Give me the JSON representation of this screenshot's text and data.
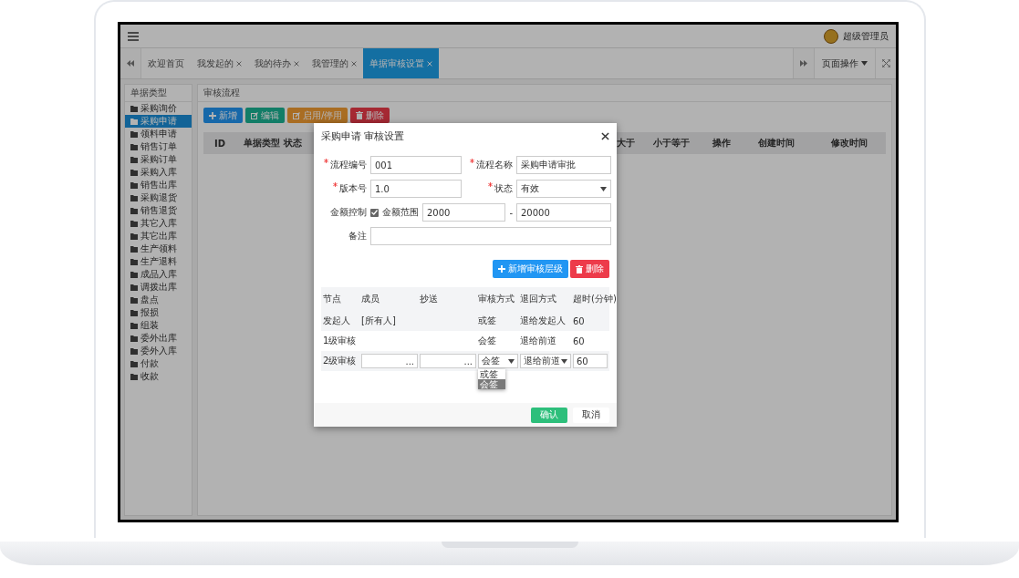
{
  "header": {
    "user": "超级管理员"
  },
  "tabs": [
    {
      "label": "欢迎首页",
      "closable": false,
      "selected": false
    },
    {
      "label": "我发起的",
      "closable": true,
      "selected": false
    },
    {
      "label": "我的待办",
      "closable": true,
      "selected": false
    },
    {
      "label": "我管理的",
      "closable": true,
      "selected": false
    },
    {
      "label": "单据审核设置",
      "closable": true,
      "selected": true
    }
  ],
  "page_menu": "页面操作",
  "sidebar": {
    "title": "单据类型",
    "items": [
      {
        "label": "采购询价",
        "selected": false
      },
      {
        "label": "采购申请",
        "selected": true
      },
      {
        "label": "领料申请",
        "selected": false
      },
      {
        "label": "销售订单",
        "selected": false
      },
      {
        "label": "采购订单",
        "selected": false
      },
      {
        "label": "采购入库",
        "selected": false
      },
      {
        "label": "销售出库",
        "selected": false
      },
      {
        "label": "采购退货",
        "selected": false
      },
      {
        "label": "销售退货",
        "selected": false
      },
      {
        "label": "其它入库",
        "selected": false
      },
      {
        "label": "其它出库",
        "selected": false
      },
      {
        "label": "生产领料",
        "selected": false
      },
      {
        "label": "生产退料",
        "selected": false
      },
      {
        "label": "成品入库",
        "selected": false
      },
      {
        "label": "调拨出库",
        "selected": false
      },
      {
        "label": "盘点",
        "selected": false
      },
      {
        "label": "报损",
        "selected": false
      },
      {
        "label": "组装",
        "selected": false
      },
      {
        "label": "委外出库",
        "selected": false
      },
      {
        "label": "委外入库",
        "selected": false
      },
      {
        "label": "付款",
        "selected": false
      },
      {
        "label": "收款",
        "selected": false
      }
    ]
  },
  "panel": {
    "title": "审核流程",
    "buttons": [
      {
        "label": "新增",
        "kind": "add"
      },
      {
        "label": "编辑",
        "kind": "edit"
      },
      {
        "label": "启用/停用",
        "kind": "toggle"
      },
      {
        "label": "删除",
        "kind": "delete"
      }
    ],
    "columns": [
      "ID",
      "单据类型",
      "状态",
      "大于",
      "小于等于",
      "操作",
      "创建时间",
      "修改时间"
    ]
  },
  "dialog": {
    "title": "采购申请 审核设置",
    "fields": [
      {
        "label": "流程编号",
        "required": true,
        "value": "001",
        "kind": "text"
      },
      {
        "label": "流程名称",
        "required": true,
        "value": "采购申请审批",
        "kind": "text"
      },
      {
        "label": "版本号",
        "required": true,
        "value": "1.0",
        "kind": "text"
      },
      {
        "label": "状态",
        "required": true,
        "value": "有效",
        "kind": "select"
      }
    ],
    "amount": {
      "label": "金额控制",
      "checked": true,
      "range_label": "金额范围",
      "min": "2000",
      "separator": "-",
      "max": "20000"
    },
    "remark": {
      "label": "备注"
    },
    "actions": [
      {
        "label": "新增审核层级",
        "kind": "add"
      },
      {
        "label": "删除",
        "kind": "delete"
      }
    ],
    "columns": [
      "节点",
      "成员",
      "抄送",
      "审核方式",
      "退回方式",
      "超时(分钟)"
    ],
    "rows": [
      {
        "kind": "text",
        "node": "发起人",
        "members": "[所有人]",
        "mode": "或签",
        "return": "退给发起人",
        "timeout": "60"
      },
      {
        "kind": "text",
        "node": "1级审核",
        "mode": "会签",
        "return": "退给前道",
        "timeout": "60"
      },
      {
        "kind": "edit",
        "node": "2级审核",
        "member_picker": "...",
        "cc_picker": "...",
        "mode": "会签",
        "mode_options": [
          {
            "label": "或签",
            "selected": false
          },
          {
            "label": "会签",
            "selected": true
          }
        ],
        "return": "退给前道",
        "timeout": "60"
      }
    ],
    "footer": [
      {
        "label": "确认",
        "kind": "primary"
      },
      {
        "label": "取消",
        "kind": "plain"
      }
    ]
  }
}
